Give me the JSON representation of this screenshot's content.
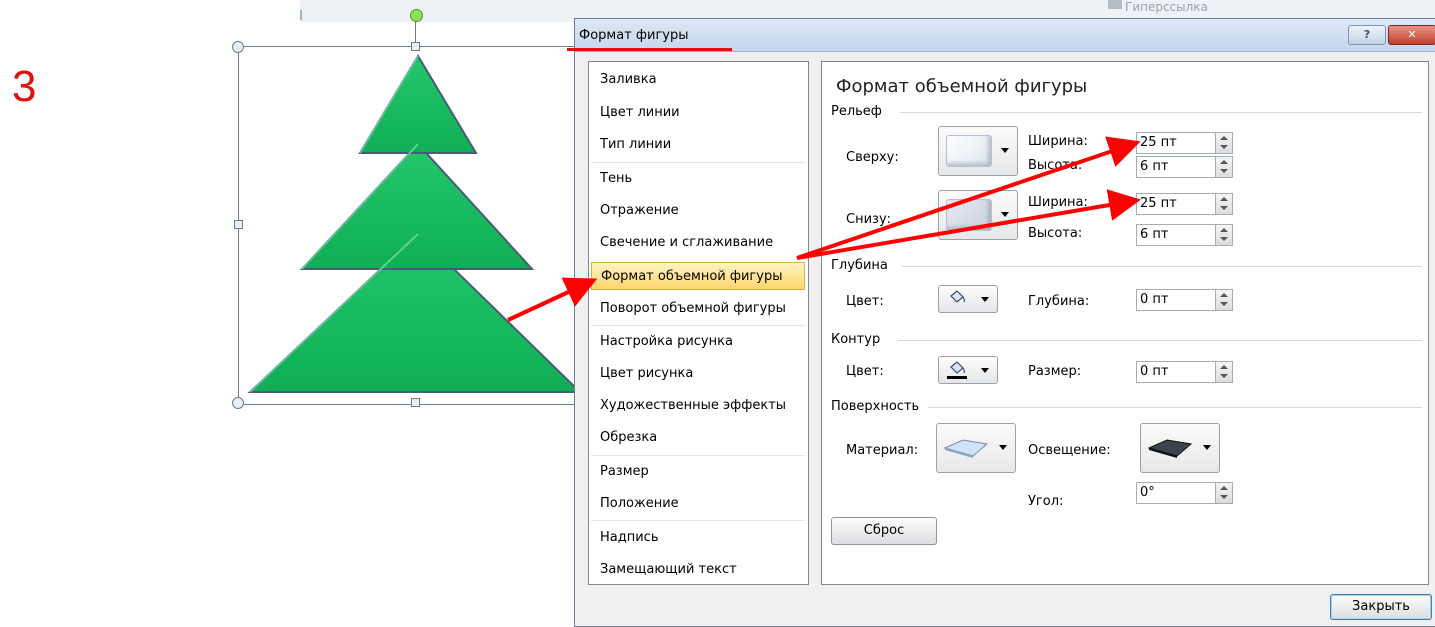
{
  "slide": {
    "number": "3"
  },
  "background": {
    "ribbon_text": "Гиперссылка"
  },
  "dialog": {
    "title": "Формат фигуры",
    "help_label": "?",
    "close_icon_label": "✕",
    "nav_items": [
      "Заливка",
      "Цвет линии",
      "Тип линии",
      "Тень",
      "Отражение",
      "Свечение и сглаживание",
      "Формат объемной фигуры",
      "Поворот объемной фигуры",
      "Настройка рисунка",
      "Цвет рисунка",
      "Художественные эффекты",
      "Обрезка",
      "Размер",
      "Положение",
      "Надпись",
      "Замещающий текст"
    ],
    "selected_index": 6,
    "panel": {
      "title": "Формат объемной фигуры",
      "bevel": {
        "section": "Рельеф",
        "top_label": "Сверху:",
        "bottom_label": "Снизу:",
        "top_width_label": "Ширина:",
        "top_width_value": "25 пт",
        "top_height_label": "Высота:",
        "top_height_value": "6 пт",
        "bottom_width_label": "Ширина:",
        "bottom_width_value": "25 пт",
        "bottom_height_label": "Высота:",
        "bottom_height_value": "6 пт"
      },
      "depth": {
        "section": "Глубина",
        "color_label": "Цвет:",
        "depth_label": "Глубина:",
        "depth_value": "0 пт"
      },
      "contour": {
        "section": "Контур",
        "color_label": "Цвет:",
        "size_label": "Размер:",
        "size_value": "0 пт"
      },
      "surface": {
        "section": "Поверхность",
        "material_label": "Материал:",
        "lighting_label": "Освещение:",
        "angle_label": "Угол:",
        "angle_value": "0°"
      },
      "reset_label": "Сброс"
    },
    "close_label": "Закрыть"
  },
  "colors": {
    "tree_fill": "#13b35a",
    "tree_outline": "#4a5b7a",
    "annotation": "#ff0000",
    "selected_nav": "#ffd76b"
  }
}
